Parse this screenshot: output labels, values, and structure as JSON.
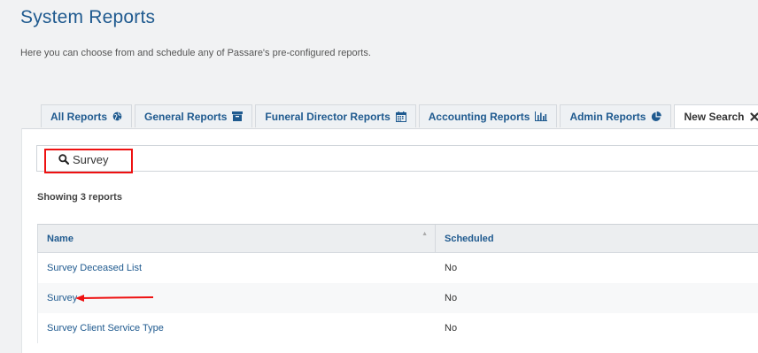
{
  "header": {
    "title": "System Reports",
    "description": "Here you can choose from and schedule any of Passare's pre-configured reports."
  },
  "tabs": [
    {
      "label": "All Reports",
      "icon": "globe-icon"
    },
    {
      "label": "General Reports",
      "icon": "archive-icon"
    },
    {
      "label": "Funeral Director Reports",
      "icon": "calendar-icon"
    },
    {
      "label": "Accounting Reports",
      "icon": "bar-chart-icon"
    },
    {
      "label": "Admin Reports",
      "icon": "pie-chart-icon"
    },
    {
      "label": "New Search",
      "icon": "close-icon",
      "active": true
    }
  ],
  "search": {
    "value": "Survey",
    "placeholder": ""
  },
  "results": {
    "showing_text": "Showing 3 reports",
    "columns": [
      "Name",
      "Scheduled"
    ],
    "rows": [
      {
        "name": "Survey Deceased List",
        "scheduled": "No"
      },
      {
        "name": "Survey",
        "scheduled": "No"
      },
      {
        "name": "Survey Client Service Type",
        "scheduled": "No"
      }
    ]
  },
  "colors": {
    "accent": "#1f5a8f",
    "annotation": "#e11111",
    "background": "#f1f2f3"
  }
}
